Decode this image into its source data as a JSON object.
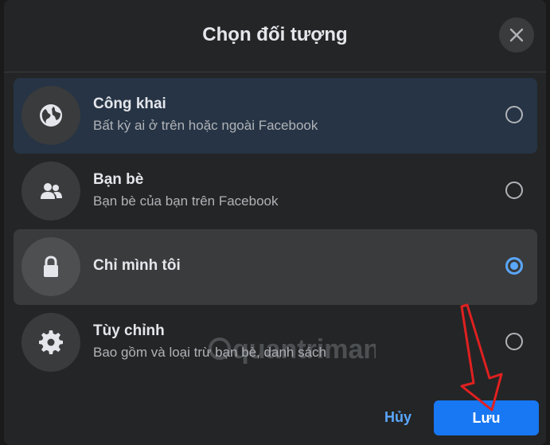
{
  "dialog": {
    "title": "Chọn đối tượng",
    "close_icon": "close-icon"
  },
  "options": [
    {
      "label": "Công khai",
      "description": "Bất kỳ ai ở trên hoặc ngoài Facebook",
      "icon": "globe-icon",
      "selected": false
    },
    {
      "label": "Bạn bè",
      "description": "Bạn bè của bạn trên Facebook",
      "icon": "friends-icon",
      "selected": false
    },
    {
      "label": "Chỉ mình tôi",
      "description": "",
      "icon": "lock-icon",
      "selected": true
    },
    {
      "label": "Tùy chỉnh",
      "description": "Bao gồm và loại trừ bạn bè, danh sách",
      "icon": "gear-icon",
      "selected": false
    }
  ],
  "footer": {
    "cancel_label": "Hủy",
    "save_label": "Lưu"
  },
  "watermark": {
    "text": "quantrimang"
  },
  "colors": {
    "background": "#242526",
    "accent": "#1877f2",
    "radio_selected": "#5aa7ff",
    "annotation_arrow": "#e02020"
  }
}
